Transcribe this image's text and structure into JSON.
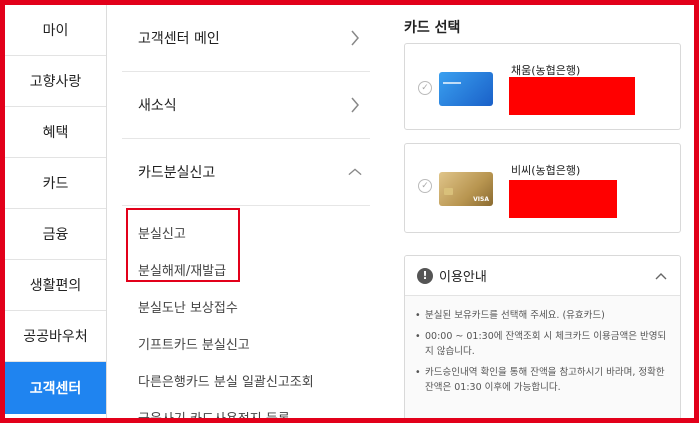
{
  "sidebar": {
    "items": [
      {
        "label": "마이"
      },
      {
        "label": "고향사랑"
      },
      {
        "label": "혜택"
      },
      {
        "label": "카드"
      },
      {
        "label": "금융"
      },
      {
        "label": "생활편의"
      },
      {
        "label": "공공바우처"
      },
      {
        "label": "고객센터",
        "active": true
      }
    ]
  },
  "menu": {
    "rows": [
      {
        "label": "고객센터 메인",
        "icon": "chevron-right-icon"
      },
      {
        "label": "새소식",
        "icon": "chevron-right-icon"
      },
      {
        "label": "카드분실신고",
        "icon": "chevron-up-icon"
      }
    ],
    "sub_items": [
      {
        "label": "분실신고"
      },
      {
        "label": "분실해제/재발급"
      },
      {
        "label": "분실도난 보상접수"
      },
      {
        "label": "기프트카드 분실신고"
      },
      {
        "label": "다른은행카드 분실 일괄신고조회"
      },
      {
        "label": "금융사기 카드사용정지 등록"
      }
    ]
  },
  "card_select": {
    "title": "카드 선택",
    "cards": [
      {
        "name": "채움(농협은행)",
        "color": "#2a80e0"
      },
      {
        "name": "비씨(농협은행)",
        "color": "#c8a860"
      }
    ]
  },
  "info": {
    "title": "이용안내",
    "lines": [
      "분실된 보유카드를 선택해 주세요. (유효카드)",
      "00:00 ~ 01:30에 잔액조회 시 체크카드 이용금액은 반영되지 않습니다.",
      "카드승인내역 확인을 통해 잔액을 참고하시기 바라며, 정확한 잔액은 01:30 이후에 가능합니다."
    ]
  },
  "colors": {
    "accent": "#1f84f0",
    "annotation_red": "#e2001a",
    "redaction": "#ff0000"
  }
}
